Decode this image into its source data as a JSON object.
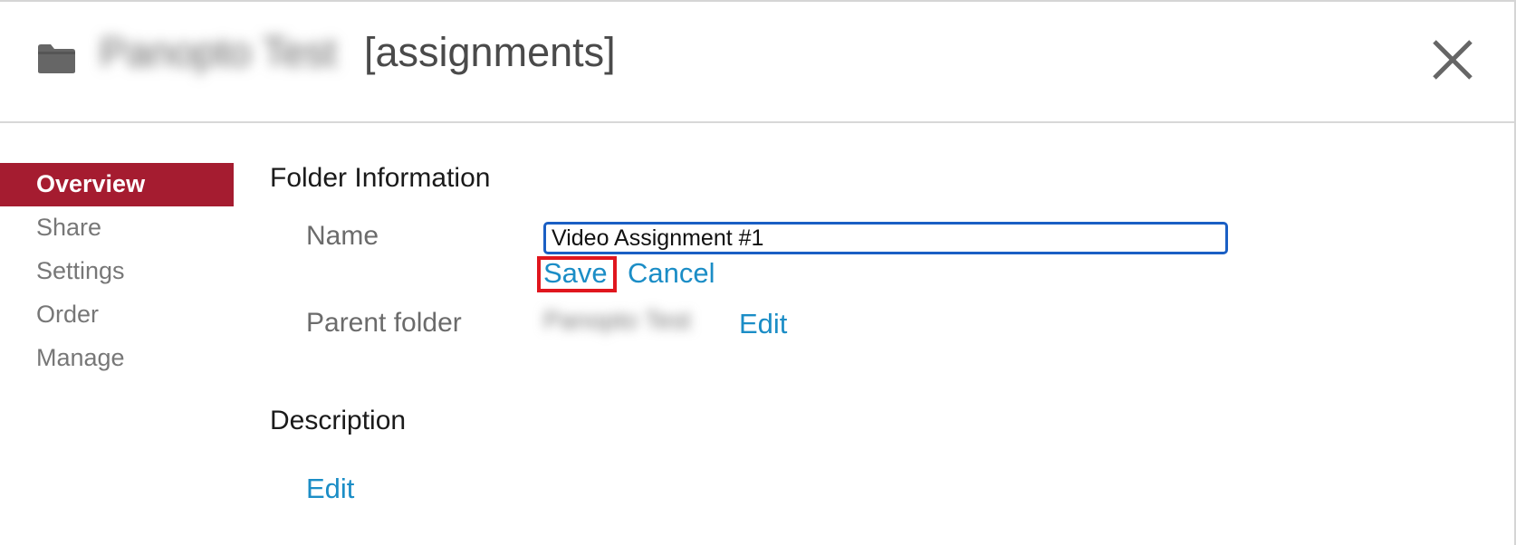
{
  "header": {
    "folder_name": "Panopto Test",
    "title_suffix": "[assignments]"
  },
  "sidebar": {
    "items": [
      {
        "label": "Overview"
      },
      {
        "label": "Share"
      },
      {
        "label": "Settings"
      },
      {
        "label": "Order"
      },
      {
        "label": "Manage"
      }
    ]
  },
  "folder_info": {
    "heading": "Folder Information",
    "name_label": "Name",
    "name_value": "Video Assignment #1",
    "save_label": "Save",
    "cancel_label": "Cancel",
    "parent_label": "Parent folder",
    "parent_value": "Panopto Test",
    "parent_edit_label": "Edit"
  },
  "description": {
    "heading": "Description",
    "edit_label": "Edit"
  },
  "colors": {
    "accent": "#a51c30",
    "link": "#1b8dc6",
    "highlight": "#e0161e",
    "input_border": "#1a5fc4"
  },
  "icons": {
    "folder": "folder-icon",
    "close": "close-icon"
  }
}
